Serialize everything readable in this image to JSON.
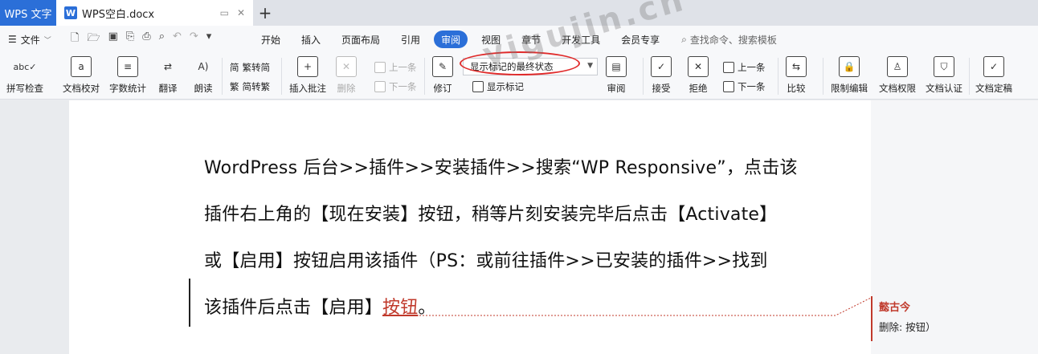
{
  "titlebar": {
    "app_tab": "WPS 文字",
    "doc_tab": "WPS空白.docx",
    "doc_icon_letter": "W",
    "new_tab": "+"
  },
  "menubar": {
    "file": "文件",
    "tabs": [
      "开始",
      "插入",
      "页面布局",
      "引用",
      "审阅",
      "视图",
      "章节",
      "开发工具",
      "会员专享"
    ],
    "active_tab": "审阅",
    "search_placeholder": "查找命令、搜索模板"
  },
  "ribbon": {
    "spell_check": "拼写检查",
    "doc_proofread": "文档校对",
    "word_count": "字数统计",
    "translate": "翻译",
    "read_aloud": "朗读",
    "trad_to_simp": "繁转简",
    "simp_to_trad": "简转繁",
    "insert_comment": "插入批注",
    "delete": "删除",
    "prev_comment": "上一条",
    "next_comment": "下一条",
    "track_changes": "修订",
    "markup_state": "显示标记的最终状态",
    "show_markup": "显示标记",
    "review": "审阅",
    "accept": "接受",
    "reject": "拒绝",
    "prev_change": "上一条",
    "next_change": "下一条",
    "compare": "比较",
    "restrict_edit": "限制编辑",
    "doc_permission": "文档权限",
    "doc_certify": "文档认证",
    "doc_finalize": "文档定稿"
  },
  "document": {
    "lines": [
      "WordPress 后台>>插件>>安装插件>>搜索“WP Responsive”，点击该",
      "插件右上角的【现在安装】按钮，稍等片刻安装完毕后点击【Activate】",
      "或【启用】按钮启用该插件（PS：或前往插件>>已安装的插件>>找到"
    ],
    "last_line_prefix": "该插件后点击【启用】",
    "last_line_deleted": "按钮",
    "last_line_suffix": "。"
  },
  "comment": {
    "author": "懿古今",
    "body": "删除: 按钮）"
  },
  "watermark": "yigujin.cn",
  "colors": {
    "accent": "#2b6fd8",
    "revision": "#c0392b",
    "highlight_ellipse": "#e02b2b"
  }
}
